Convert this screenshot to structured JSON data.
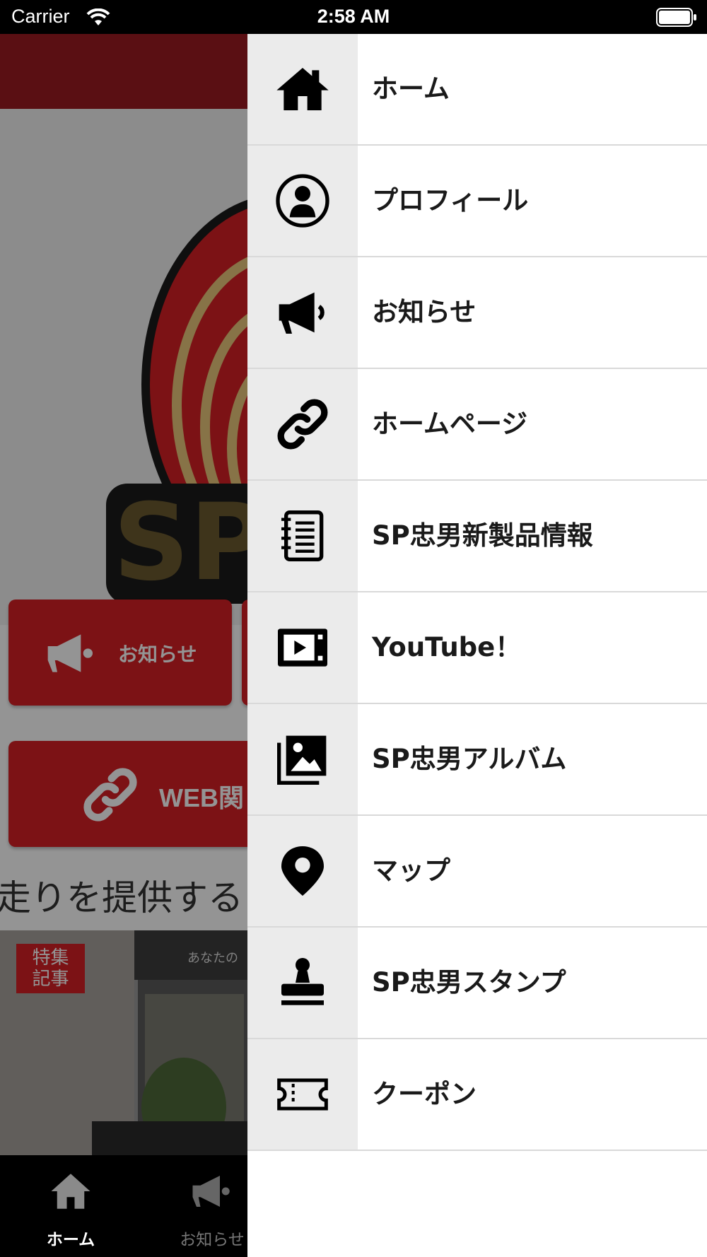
{
  "status_bar": {
    "carrier": "Carrier",
    "time": "2:58 AM"
  },
  "background": {
    "tiles": {
      "news_label": "お知らせ",
      "web_label": "WEB関"
    },
    "ticker": "走りを提供する",
    "article_badge": "特集\n記事",
    "article_sign": "あなたの"
  },
  "tab_bar": [
    {
      "label": "ホーム",
      "icon": "home-icon"
    },
    {
      "label": "お知らせ",
      "icon": "megaphone-icon"
    }
  ],
  "drawer": {
    "items": [
      {
        "label": "ホーム",
        "icon": "home-icon"
      },
      {
        "label": "プロフィール",
        "icon": "profile-icon"
      },
      {
        "label": "お知らせ",
        "icon": "megaphone-icon"
      },
      {
        "label": "ホームページ",
        "icon": "link-icon"
      },
      {
        "label": "SP忠男新製品情報",
        "icon": "notebook-icon"
      },
      {
        "label": "YouTube！",
        "icon": "video-icon"
      },
      {
        "label": "SP忠男アルバム",
        "icon": "gallery-icon"
      },
      {
        "label": "マップ",
        "icon": "map-pin-icon"
      },
      {
        "label": "SP忠男スタンプ",
        "icon": "stamp-icon"
      },
      {
        "label": "クーポン",
        "icon": "coupon-icon"
      }
    ]
  },
  "colors": {
    "header": "#9b1b22",
    "tile": "#d61f25",
    "drawer_icon_bg": "#ebebeb"
  }
}
